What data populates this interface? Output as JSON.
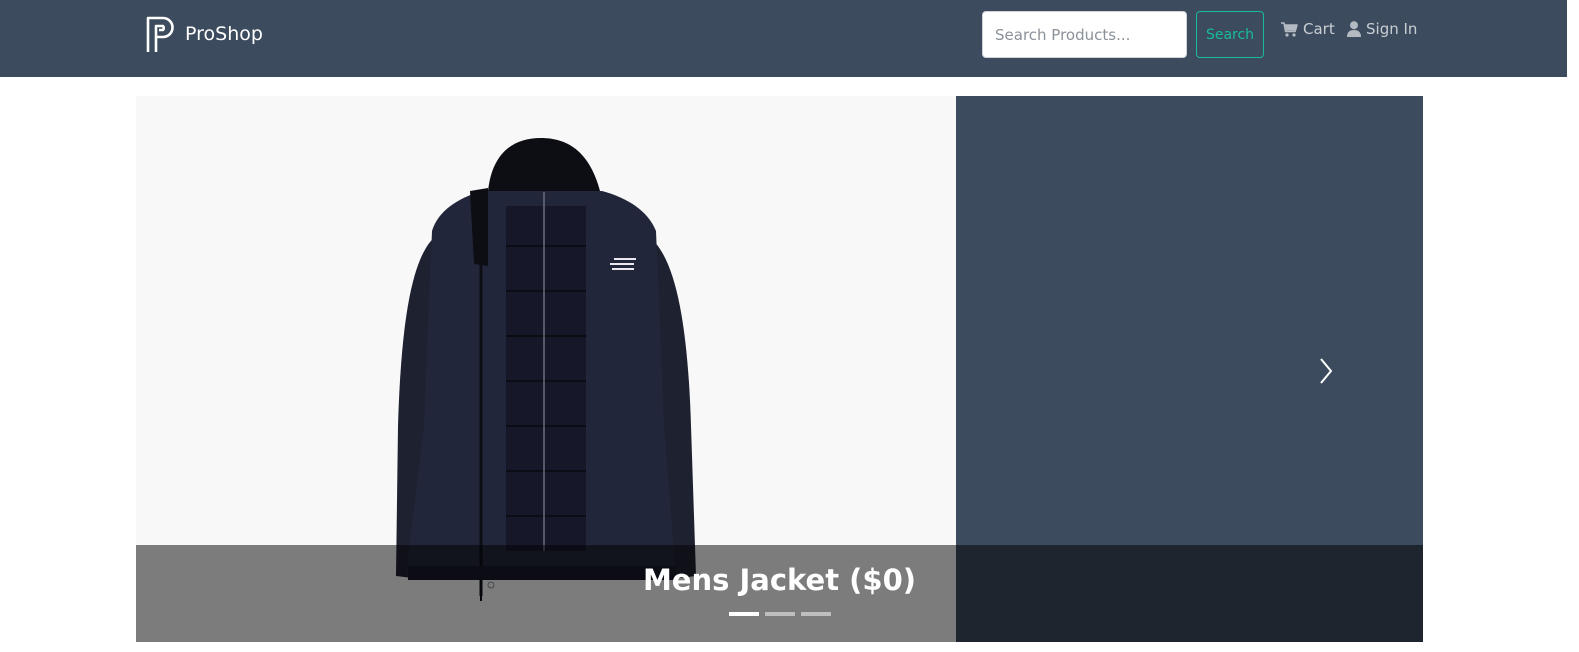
{
  "colors": {
    "navbar": "#3c4b5d",
    "accent": "#18bc9c",
    "slide_background": "#f8f8f8",
    "carousel_background": "#3c4b5d"
  },
  "header": {
    "brand": {
      "name": "ProShop",
      "logo_icon": "proshop-logo-icon"
    },
    "search": {
      "placeholder": "Search Products...",
      "value": "",
      "button_label": "Search"
    },
    "nav": {
      "cart": {
        "label": "Cart",
        "icon": "cart-icon"
      },
      "sign_in": {
        "label": "Sign In",
        "icon": "user-icon"
      }
    }
  },
  "carousel": {
    "active_index": 0,
    "slides": [
      {
        "title": "Mens Jacket ($0)",
        "image": "black hooded jacket"
      },
      {
        "title": "",
        "image": ""
      },
      {
        "title": "",
        "image": ""
      }
    ],
    "controls": {
      "prev_icon": "chevron-left-icon",
      "next_icon": "chevron-right-icon"
    }
  }
}
